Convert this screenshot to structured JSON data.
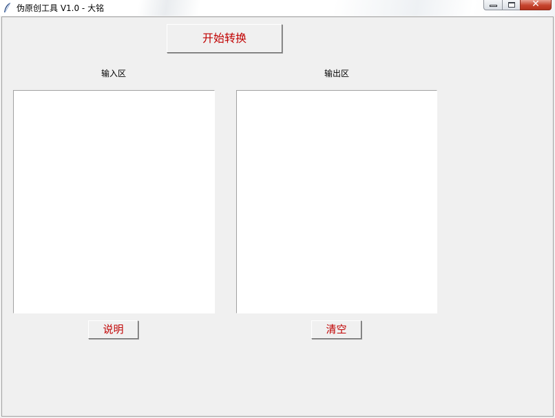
{
  "window": {
    "title": "伪原创工具 V1.0 - 大铭",
    "icon": "feather-icon",
    "close_glyph": "✕"
  },
  "toolbar": {
    "start_label": "开始转换"
  },
  "input_area": {
    "label": "输入区",
    "value": ""
  },
  "output_area": {
    "label": "输出区",
    "value": ""
  },
  "buttons": {
    "help_label": "说明",
    "clear_label": "清空"
  },
  "colors": {
    "button_text": "#c00000",
    "background": "#f0f0f0",
    "text_bg": "#ffffff"
  }
}
